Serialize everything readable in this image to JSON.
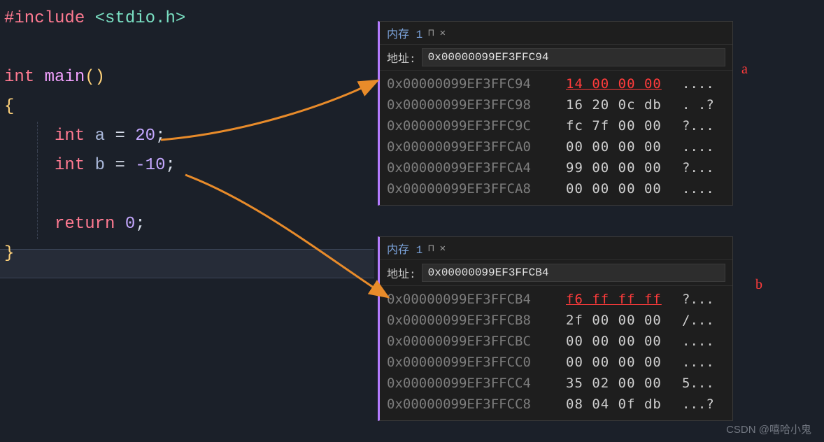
{
  "code": {
    "include_directive": "#include",
    "include_header": "<stdio.h>",
    "int_kw": "int",
    "main_fn": "main",
    "parens": "()",
    "open_brace": "{",
    "var_a_type": "int",
    "var_a_name": "a",
    "var_a_eq": " = ",
    "var_a_val": "20",
    "var_b_type": "int",
    "var_b_name": "b",
    "var_b_eq": " = ",
    "var_b_val": "-10",
    "return_kw": "return",
    "return_val": "0",
    "close_brace": "}",
    "semi": ";"
  },
  "mem_a": {
    "title": "内存 1",
    "addr_label": "地址:",
    "addr_value": "0x00000099EF3FFC94",
    "rows": [
      {
        "addr": "0x00000099EF3FFC94",
        "bytes": "14 00 00 00",
        "ascii": "...."
      },
      {
        "addr": "0x00000099EF3FFC98",
        "bytes": "16 20 0c db",
        "ascii": ". .?"
      },
      {
        "addr": "0x00000099EF3FFC9C",
        "bytes": "fc 7f 00 00",
        "ascii": "?..."
      },
      {
        "addr": "0x00000099EF3FFCA0",
        "bytes": "00 00 00 00",
        "ascii": "...."
      },
      {
        "addr": "0x00000099EF3FFCA4",
        "bytes": "99 00 00 00",
        "ascii": "?..."
      },
      {
        "addr": "0x00000099EF3FFCA8",
        "bytes": "00 00 00 00",
        "ascii": "...."
      }
    ]
  },
  "mem_b": {
    "title": "内存 1",
    "addr_label": "地址:",
    "addr_value": "0x00000099EF3FFCB4",
    "rows": [
      {
        "addr": "0x00000099EF3FFCB4",
        "bytes": "f6 ff ff ff",
        "ascii": "?..."
      },
      {
        "addr": "0x00000099EF3FFCB8",
        "bytes": "2f 00 00 00",
        "ascii": "/..."
      },
      {
        "addr": "0x00000099EF3FFCBC",
        "bytes": "00 00 00 00",
        "ascii": "...."
      },
      {
        "addr": "0x00000099EF3FFCC0",
        "bytes": "00 00 00 00",
        "ascii": "...."
      },
      {
        "addr": "0x00000099EF3FFCC4",
        "bytes": "35 02 00 00",
        "ascii": "5..."
      },
      {
        "addr": "0x00000099EF3FFCC8",
        "bytes": "08 04 0f db",
        "ascii": "...?"
      }
    ]
  },
  "annotations": {
    "a": "a",
    "b": "b"
  },
  "watermark": "CSDN @嘻哈小鬼"
}
